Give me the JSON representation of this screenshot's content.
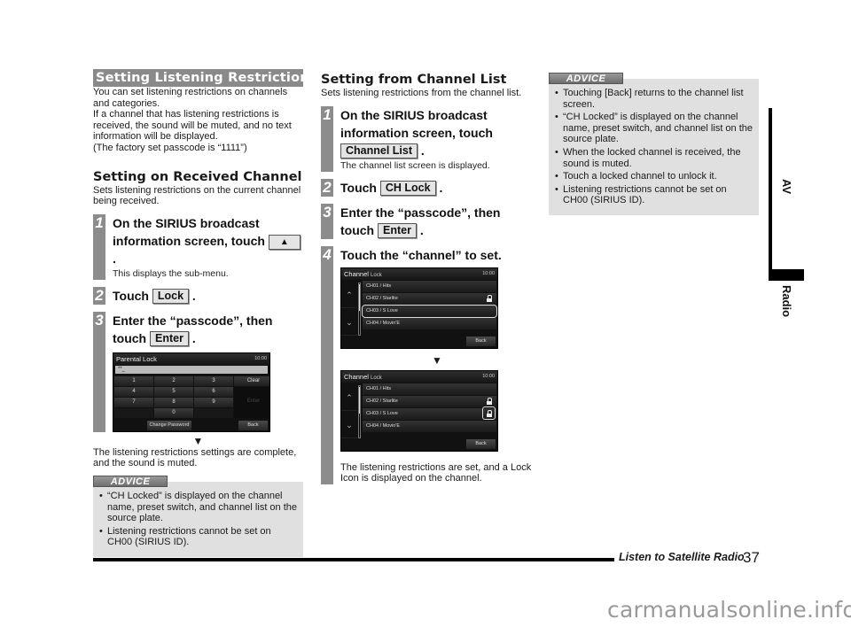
{
  "col1": {
    "band_title": "Setting Listening Restrictions",
    "intro_lines": [
      "You can set listening restrictions on channels and categories.",
      "If a channel that has listening restrictions is received, the sound will be muted, and no text information will be displayed.",
      "(The factory set passcode is “1111”)"
    ],
    "section_title": "Setting on Received Channel",
    "section_desc": "Sets listening restrictions on the current channel being received.",
    "steps": [
      {
        "num": "1",
        "text": "On the SIRIUS broadcast information screen, touch",
        "key": "▲",
        "note": "This displays the sub-menu."
      },
      {
        "num": "2",
        "text": "Touch",
        "key": "Lock"
      },
      {
        "num": "3",
        "text": "Enter the “passcode”, then touch",
        "key": "Enter"
      }
    ],
    "keypad_screen": {
      "title": "Parental Lock",
      "clock": "10:00",
      "input": "**_",
      "keys": [
        "1",
        "2",
        "3",
        "Clear",
        "4",
        "5",
        "6",
        "7",
        "8",
        "9",
        "0"
      ],
      "enter": "Enter",
      "change_password": "Change Password",
      "back": "Back"
    },
    "arrow": "▼",
    "result": "The listening restrictions settings are complete, and the sound is muted.",
    "advice": {
      "label": "ADVICE",
      "items": [
        "“CH Locked” is displayed on the channel name, preset switch, and channel list on the source plate.",
        "Listening restrictions cannot be set on CH00 (SIRIUS ID)."
      ]
    }
  },
  "col2": {
    "section_title": "Setting from Channel List",
    "section_desc": "Sets listening restrictions from the channel list.",
    "steps": [
      {
        "num": "1",
        "text": "On the SIRIUS broadcast information screen, touch",
        "key": "Channel List",
        "note": "The channel list screen is displayed."
      },
      {
        "num": "2",
        "text": "Touch",
        "key": "CH Lock"
      },
      {
        "num": "3",
        "text": "Enter the “passcode”, then touch",
        "key": "Enter"
      },
      {
        "num": "4",
        "text": "Touch the “channel” to set."
      }
    ],
    "channel_screen": {
      "title": "Channel",
      "subtitle": "Lock",
      "clock": "10:00",
      "channels": [
        "CH01 / Hits",
        "CH02 / Starlite",
        "CH03 / S Love",
        "CH04 / Movin'E"
      ],
      "back": "Back"
    },
    "arrow": "▼",
    "result": "The listening restrictions are set, and a Lock Icon is displayed on the channel."
  },
  "col3": {
    "advice": {
      "label": "ADVICE",
      "items": [
        "Touching [Back] returns to the channel list screen.",
        "“CH Locked” is displayed on the channel name, preset switch, and channel list on the source plate.",
        "When the locked channel is received, the sound is muted.",
        "Touch a locked channel to unlock it.",
        "Listening restrictions cannot be set on CH00 (SIRIUS ID)."
      ]
    }
  },
  "side_tab": {
    "section": "AV",
    "subsection": "Radio"
  },
  "footer": {
    "title": "Listen to Satellite Radio",
    "page": "37"
  },
  "watermark": "carmanualsonline.info"
}
